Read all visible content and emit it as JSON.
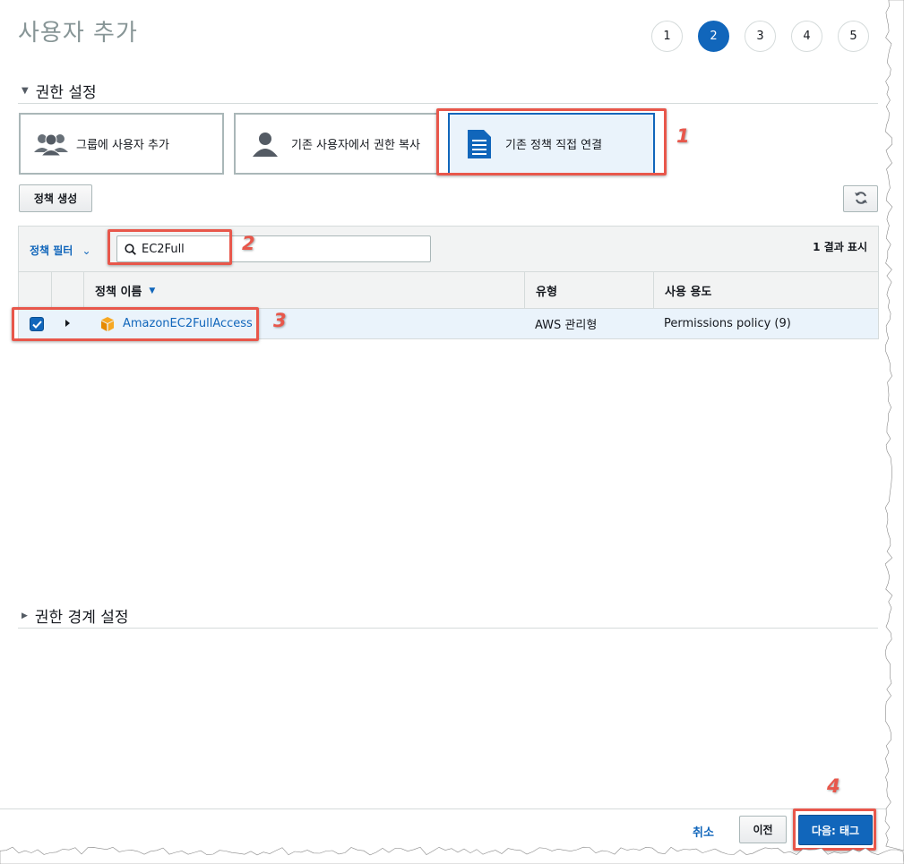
{
  "header": {
    "title": "사용자 추가"
  },
  "steps": [
    {
      "label": "1",
      "active": false
    },
    {
      "label": "2",
      "active": true
    },
    {
      "label": "3",
      "active": false
    },
    {
      "label": "4",
      "active": false
    },
    {
      "label": "5",
      "active": false
    }
  ],
  "permissions": {
    "section_title": "권한 설정",
    "options": [
      {
        "label": "그룹에 사용자 추가",
        "icon": "users-group-icon",
        "selected": false
      },
      {
        "label": "기존 사용자에서 권한 복사",
        "icon": "user-icon",
        "selected": false
      },
      {
        "label": "기존 정책 직접 연결",
        "icon": "document-icon",
        "selected": true
      }
    ],
    "create_policy_label": "정책 생성",
    "refresh_icon": "refresh-icon"
  },
  "filter": {
    "label": "정책 필터",
    "search_value": "EC2Full",
    "result_count": "1 결과 표시"
  },
  "table": {
    "columns": [
      "정책 이름",
      "유형",
      "사용 용도"
    ],
    "rows": [
      {
        "checked": true,
        "name": "AmazonEC2FullAccess",
        "type": "AWS 관리형",
        "usage": "Permissions policy (9)",
        "icon": "aws-cube-icon"
      }
    ]
  },
  "boundary": {
    "section_title": "권한 경계 설정"
  },
  "footer": {
    "cancel_label": "취소",
    "previous_label": "이전",
    "next_label": "다음: 태그"
  },
  "annotations": [
    "1",
    "2",
    "3",
    "4"
  ],
  "colors": {
    "accent": "#1166bb",
    "annotation": "#e8574b",
    "selected_bg": "#eaf3fb"
  }
}
